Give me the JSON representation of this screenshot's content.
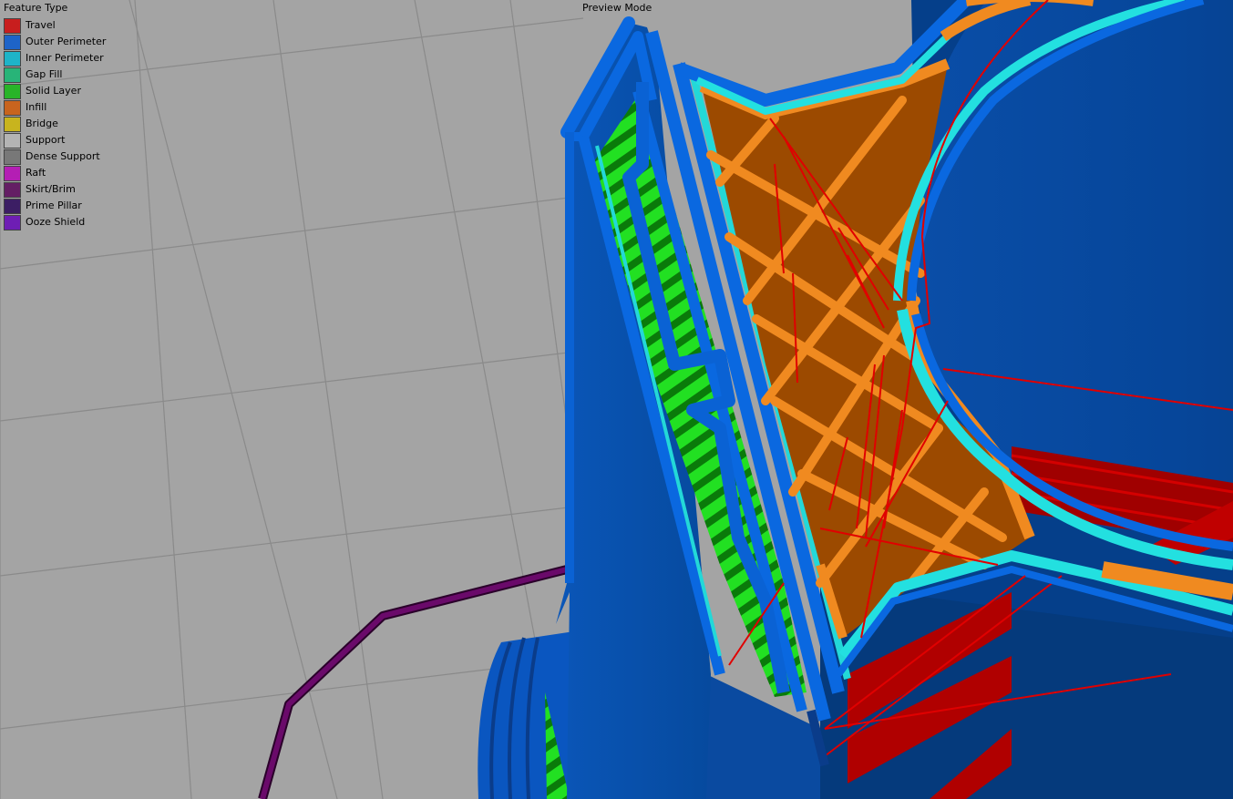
{
  "legend": {
    "title": "Feature Type",
    "items": [
      {
        "label": "Travel",
        "color": "#c81e1e"
      },
      {
        "label": "Outer Perimeter",
        "color": "#1e64c8"
      },
      {
        "label": "Inner Perimeter",
        "color": "#1eb4c8"
      },
      {
        "label": "Gap Fill",
        "color": "#28b478"
      },
      {
        "label": "Solid Layer",
        "color": "#28b428"
      },
      {
        "label": "Infill",
        "color": "#c8641e"
      },
      {
        "label": "Bridge",
        "color": "#c8b41e"
      },
      {
        "label": "Support",
        "color": "#b4b4b4"
      },
      {
        "label": "Dense Support",
        "color": "#787878"
      },
      {
        "label": "Raft",
        "color": "#b41eb4"
      },
      {
        "label": "Skirt/Brim",
        "color": "#641e64"
      },
      {
        "label": "Prime Pillar",
        "color": "#3c1e64"
      },
      {
        "label": "Ooze Shield",
        "color": "#6e1eb4"
      }
    ]
  },
  "preview": {
    "mode_label": "Preview Mode"
  },
  "colors": {
    "background": "#a4a4a4",
    "grid": "#8a8a8a",
    "outer_perimeter": "#0a5ac8",
    "outer_perimeter_dark": "#003a80",
    "inner_perimeter": "#28e0e0",
    "infill": "#e87a10",
    "infill_dark": "#a04a00",
    "solid_layer": "#22d022",
    "travel": "#e00000",
    "skirt": "#5a0a5a"
  }
}
